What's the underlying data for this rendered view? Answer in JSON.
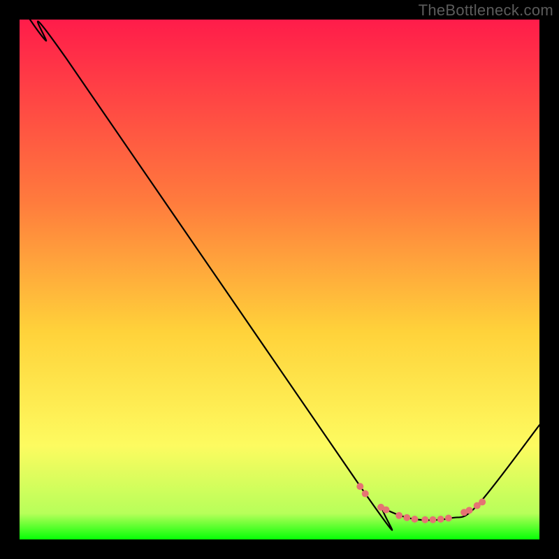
{
  "watermark": "TheBottleneck.com",
  "chart_data": {
    "type": "line",
    "title": "",
    "xlabel": "",
    "ylabel": "",
    "xlim": [
      0,
      100
    ],
    "ylim": [
      0,
      100
    ],
    "grid": false,
    "legend": false,
    "gradient_stops": [
      {
        "offset": 0,
        "color": "#ff1c4a"
      },
      {
        "offset": 35,
        "color": "#ff7b3d"
      },
      {
        "offset": 60,
        "color": "#ffd23a"
      },
      {
        "offset": 82,
        "color": "#fdfb60"
      },
      {
        "offset": 95,
        "color": "#b7ff5a"
      },
      {
        "offset": 100,
        "color": "#06ff06"
      }
    ],
    "series": [
      {
        "name": "bottleneck-curve",
        "color": "#000000",
        "x": [
          2,
          5,
          9,
          66.5,
          70,
          76,
          83,
          88,
          100
        ],
        "y": [
          100,
          96,
          92.5,
          8.8,
          6,
          3.9,
          4.1,
          6.5,
          22
        ]
      }
    ],
    "markers": {
      "name": "highlight-dots",
      "color": "#e57373",
      "points": [
        {
          "x": 65.5,
          "y": 10.2
        },
        {
          "x": 66.5,
          "y": 8.8
        },
        {
          "x": 69.5,
          "y": 6.2
        },
        {
          "x": 70.5,
          "y": 5.7
        },
        {
          "x": 73.0,
          "y": 4.6
        },
        {
          "x": 74.5,
          "y": 4.2
        },
        {
          "x": 76.0,
          "y": 3.9
        },
        {
          "x": 78.0,
          "y": 3.8
        },
        {
          "x": 79.5,
          "y": 3.8
        },
        {
          "x": 81.0,
          "y": 3.9
        },
        {
          "x": 82.5,
          "y": 4.1
        },
        {
          "x": 85.5,
          "y": 5.2
        },
        {
          "x": 86.5,
          "y": 5.6
        },
        {
          "x": 88.0,
          "y": 6.5
        },
        {
          "x": 89.0,
          "y": 7.2
        }
      ]
    }
  }
}
